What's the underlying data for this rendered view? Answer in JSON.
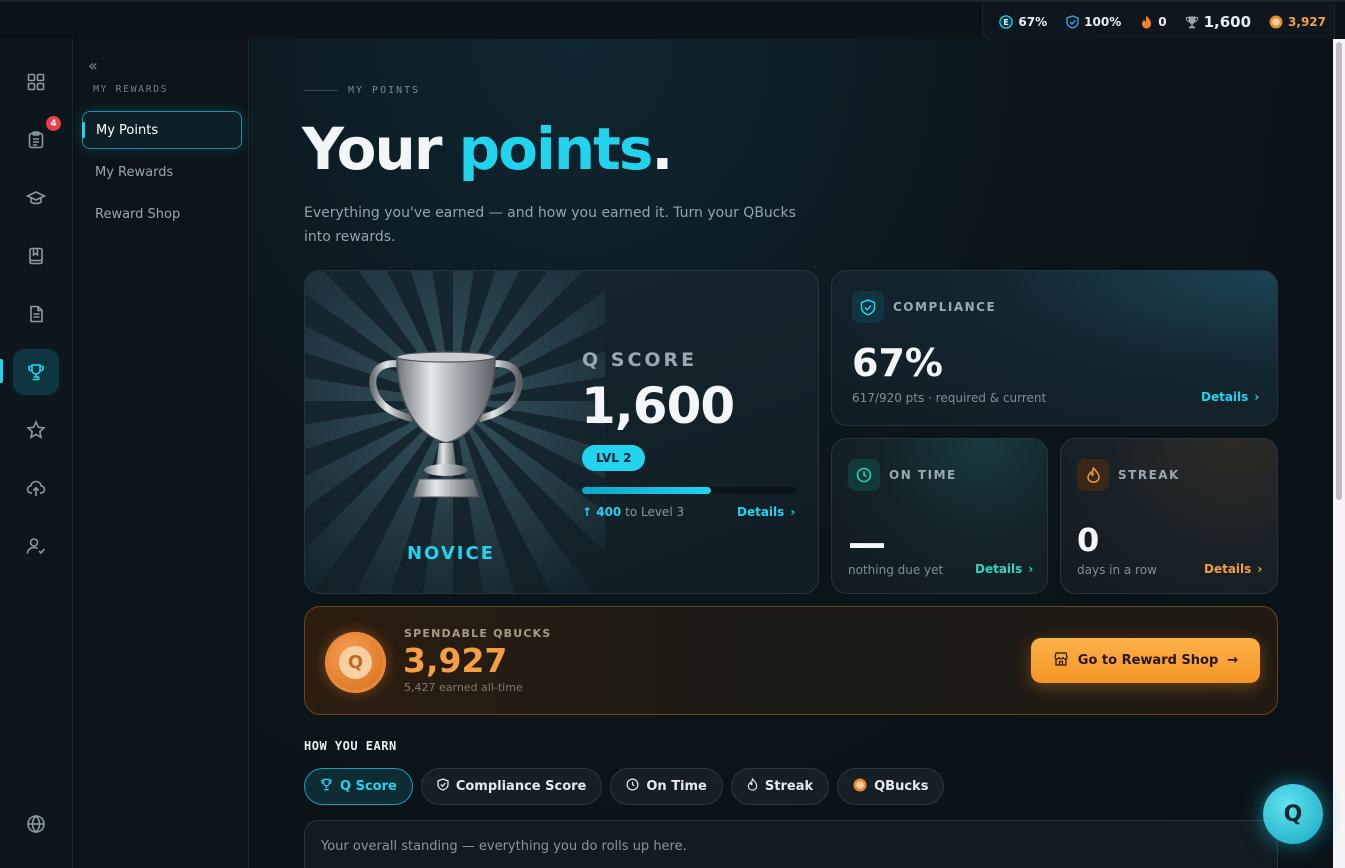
{
  "topbar": {
    "compliance": "67%",
    "ontime": "100%",
    "streak": "0",
    "qscore": "1,600",
    "qbucks": "3,927"
  },
  "rail": {
    "notification_count": "4",
    "icons": [
      "dashboard-icon",
      "tasks-icon",
      "learning-icon",
      "library-icon",
      "documents-icon",
      "trophy-icon",
      "star-icon",
      "upload-icon",
      "people-icon",
      "globe-icon"
    ]
  },
  "sidebar": {
    "section": "MY REWARDS",
    "items": [
      {
        "label": "My Points",
        "active": true
      },
      {
        "label": "My Rewards",
        "active": false
      },
      {
        "label": "Reward Shop",
        "active": false
      }
    ]
  },
  "header": {
    "eyebrow": "MY POINTS",
    "title_part1": "Your ",
    "title_accent": "points",
    "title_end": ".",
    "description": "Everything you've earned — and how you earned it. Turn your QBucks into rewards."
  },
  "qscore": {
    "label": "Q SCORE",
    "value": "1,600",
    "level": "LVL 2",
    "rank": "NOVICE",
    "progress_fraction": 0.6,
    "to_next_amount": "400",
    "to_next_text": " to Level 3",
    "details": "Details"
  },
  "compliance": {
    "label": "COMPLIANCE",
    "value": "67%",
    "sub": "617/920 pts · required & current",
    "details": "Details"
  },
  "ontime": {
    "label": "ON TIME",
    "value": "—",
    "sub": "nothing due yet",
    "details": "Details"
  },
  "streak": {
    "label": "STREAK",
    "value": "0",
    "sub": "days in a row",
    "details": "Details"
  },
  "qbucks": {
    "label": "SPENDABLE QBUCKS",
    "value": "3,927",
    "sub": "5,427 earned all-time",
    "coin_letter": "Q",
    "button": "Go to Reward Shop"
  },
  "earn": {
    "heading": "HOW YOU EARN",
    "tabs": [
      {
        "label": "Q Score",
        "active": true
      },
      {
        "label": "Compliance Score",
        "active": false
      },
      {
        "label": "On Time",
        "active": false
      },
      {
        "label": "Streak",
        "active": false
      },
      {
        "label": "QBucks",
        "active": false
      }
    ],
    "description": "Your overall standing — everything you do rolls up here."
  },
  "fab": {
    "letter": "Q"
  },
  "colors": {
    "accent": "#22d3ee",
    "orange": "#f59e42",
    "teal": "#2dd4bf"
  }
}
